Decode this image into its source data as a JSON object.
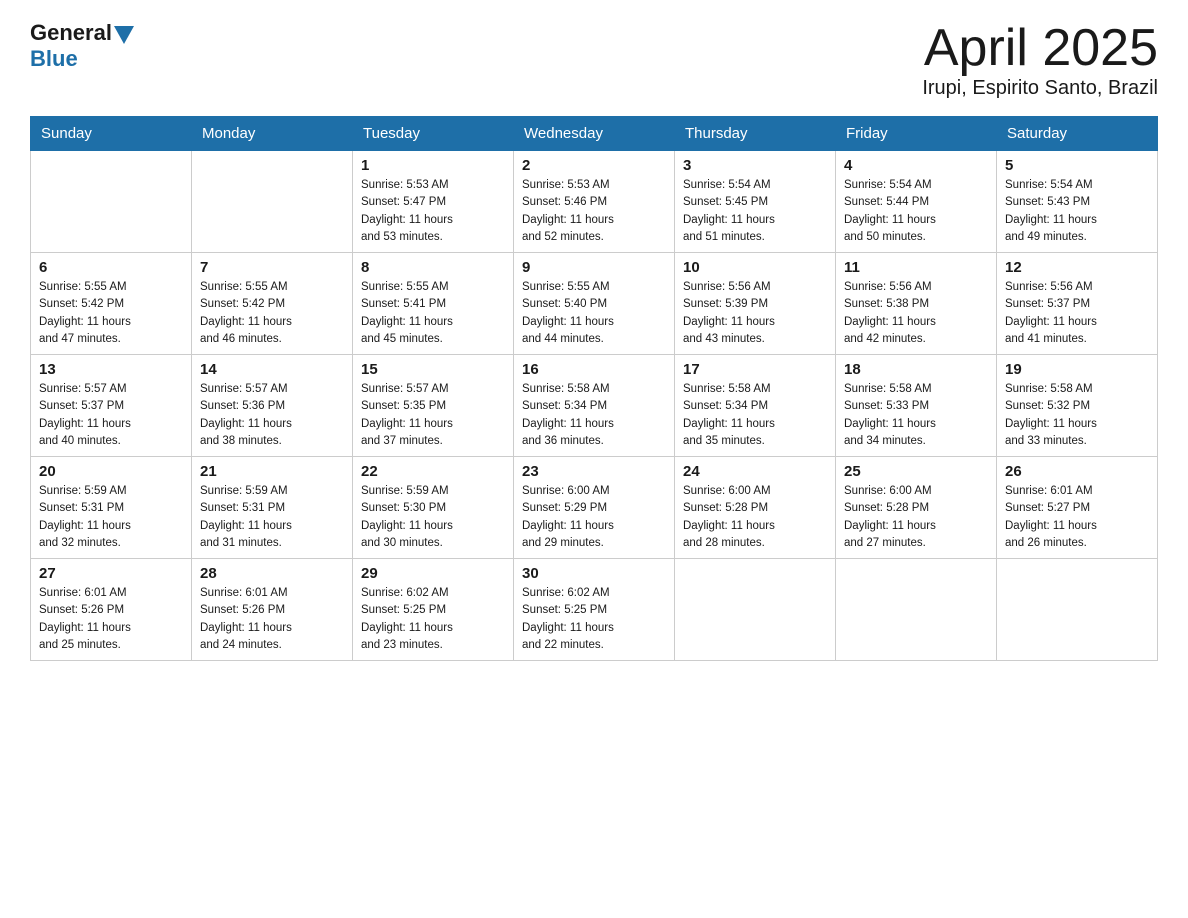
{
  "header": {
    "logo_general": "General",
    "logo_blue": "Blue",
    "month": "April 2025",
    "location": "Irupi, Espirito Santo, Brazil"
  },
  "weekdays": [
    "Sunday",
    "Monday",
    "Tuesday",
    "Wednesday",
    "Thursday",
    "Friday",
    "Saturday"
  ],
  "weeks": [
    [
      {
        "day": "",
        "info": ""
      },
      {
        "day": "",
        "info": ""
      },
      {
        "day": "1",
        "info": "Sunrise: 5:53 AM\nSunset: 5:47 PM\nDaylight: 11 hours\nand 53 minutes."
      },
      {
        "day": "2",
        "info": "Sunrise: 5:53 AM\nSunset: 5:46 PM\nDaylight: 11 hours\nand 52 minutes."
      },
      {
        "day": "3",
        "info": "Sunrise: 5:54 AM\nSunset: 5:45 PM\nDaylight: 11 hours\nand 51 minutes."
      },
      {
        "day": "4",
        "info": "Sunrise: 5:54 AM\nSunset: 5:44 PM\nDaylight: 11 hours\nand 50 minutes."
      },
      {
        "day": "5",
        "info": "Sunrise: 5:54 AM\nSunset: 5:43 PM\nDaylight: 11 hours\nand 49 minutes."
      }
    ],
    [
      {
        "day": "6",
        "info": "Sunrise: 5:55 AM\nSunset: 5:42 PM\nDaylight: 11 hours\nand 47 minutes."
      },
      {
        "day": "7",
        "info": "Sunrise: 5:55 AM\nSunset: 5:42 PM\nDaylight: 11 hours\nand 46 minutes."
      },
      {
        "day": "8",
        "info": "Sunrise: 5:55 AM\nSunset: 5:41 PM\nDaylight: 11 hours\nand 45 minutes."
      },
      {
        "day": "9",
        "info": "Sunrise: 5:55 AM\nSunset: 5:40 PM\nDaylight: 11 hours\nand 44 minutes."
      },
      {
        "day": "10",
        "info": "Sunrise: 5:56 AM\nSunset: 5:39 PM\nDaylight: 11 hours\nand 43 minutes."
      },
      {
        "day": "11",
        "info": "Sunrise: 5:56 AM\nSunset: 5:38 PM\nDaylight: 11 hours\nand 42 minutes."
      },
      {
        "day": "12",
        "info": "Sunrise: 5:56 AM\nSunset: 5:37 PM\nDaylight: 11 hours\nand 41 minutes."
      }
    ],
    [
      {
        "day": "13",
        "info": "Sunrise: 5:57 AM\nSunset: 5:37 PM\nDaylight: 11 hours\nand 40 minutes."
      },
      {
        "day": "14",
        "info": "Sunrise: 5:57 AM\nSunset: 5:36 PM\nDaylight: 11 hours\nand 38 minutes."
      },
      {
        "day": "15",
        "info": "Sunrise: 5:57 AM\nSunset: 5:35 PM\nDaylight: 11 hours\nand 37 minutes."
      },
      {
        "day": "16",
        "info": "Sunrise: 5:58 AM\nSunset: 5:34 PM\nDaylight: 11 hours\nand 36 minutes."
      },
      {
        "day": "17",
        "info": "Sunrise: 5:58 AM\nSunset: 5:34 PM\nDaylight: 11 hours\nand 35 minutes."
      },
      {
        "day": "18",
        "info": "Sunrise: 5:58 AM\nSunset: 5:33 PM\nDaylight: 11 hours\nand 34 minutes."
      },
      {
        "day": "19",
        "info": "Sunrise: 5:58 AM\nSunset: 5:32 PM\nDaylight: 11 hours\nand 33 minutes."
      }
    ],
    [
      {
        "day": "20",
        "info": "Sunrise: 5:59 AM\nSunset: 5:31 PM\nDaylight: 11 hours\nand 32 minutes."
      },
      {
        "day": "21",
        "info": "Sunrise: 5:59 AM\nSunset: 5:31 PM\nDaylight: 11 hours\nand 31 minutes."
      },
      {
        "day": "22",
        "info": "Sunrise: 5:59 AM\nSunset: 5:30 PM\nDaylight: 11 hours\nand 30 minutes."
      },
      {
        "day": "23",
        "info": "Sunrise: 6:00 AM\nSunset: 5:29 PM\nDaylight: 11 hours\nand 29 minutes."
      },
      {
        "day": "24",
        "info": "Sunrise: 6:00 AM\nSunset: 5:28 PM\nDaylight: 11 hours\nand 28 minutes."
      },
      {
        "day": "25",
        "info": "Sunrise: 6:00 AM\nSunset: 5:28 PM\nDaylight: 11 hours\nand 27 minutes."
      },
      {
        "day": "26",
        "info": "Sunrise: 6:01 AM\nSunset: 5:27 PM\nDaylight: 11 hours\nand 26 minutes."
      }
    ],
    [
      {
        "day": "27",
        "info": "Sunrise: 6:01 AM\nSunset: 5:26 PM\nDaylight: 11 hours\nand 25 minutes."
      },
      {
        "day": "28",
        "info": "Sunrise: 6:01 AM\nSunset: 5:26 PM\nDaylight: 11 hours\nand 24 minutes."
      },
      {
        "day": "29",
        "info": "Sunrise: 6:02 AM\nSunset: 5:25 PM\nDaylight: 11 hours\nand 23 minutes."
      },
      {
        "day": "30",
        "info": "Sunrise: 6:02 AM\nSunset: 5:25 PM\nDaylight: 11 hours\nand 22 minutes."
      },
      {
        "day": "",
        "info": ""
      },
      {
        "day": "",
        "info": ""
      },
      {
        "day": "",
        "info": ""
      }
    ]
  ]
}
